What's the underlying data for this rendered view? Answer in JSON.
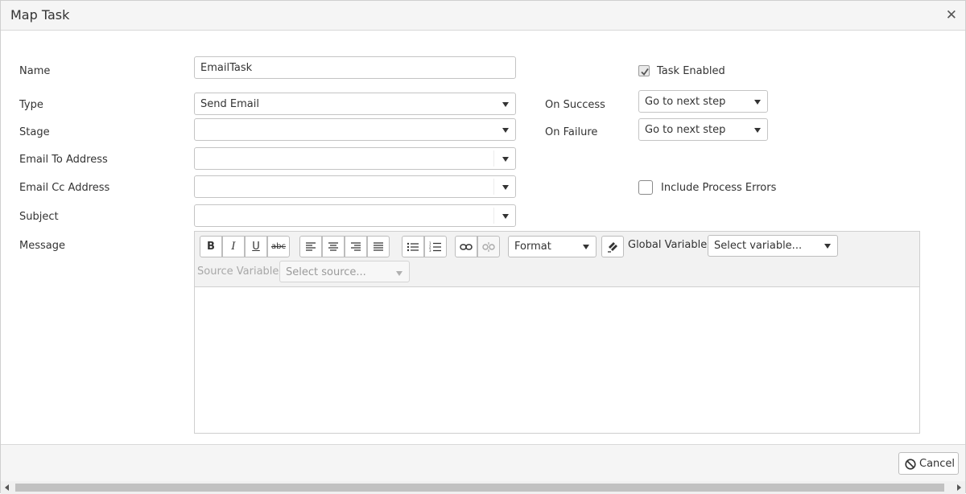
{
  "dialog": {
    "title": "Map Task",
    "close_glyph": "✕"
  },
  "form": {
    "name": {
      "label": "Name",
      "value": "EmailTask"
    },
    "type": {
      "label": "Type",
      "value": "Send Email"
    },
    "stage": {
      "label": "Stage",
      "value": ""
    },
    "email_to": {
      "label": "Email To Address",
      "value": ""
    },
    "email_cc": {
      "label": "Email Cc Address",
      "value": ""
    },
    "subject": {
      "label": "Subject",
      "value": ""
    },
    "message": {
      "label": "Message"
    },
    "task_enabled": {
      "label": "Task Enabled",
      "checked": true
    },
    "on_success": {
      "label": "On Success",
      "value": "Go to next step"
    },
    "on_failure": {
      "label": "On Failure",
      "value": "Go to next step"
    },
    "include_process_errors": {
      "label": "Include Process Errors",
      "checked": false
    }
  },
  "editor": {
    "toolbar": {
      "bold": "B",
      "italic": "I",
      "underline": "U",
      "strike": "abc",
      "format_select": "Format",
      "global_variable_label": "Global Variable:",
      "global_variable_placeholder": "Select variable...",
      "source_variable_label": "Source Variable:",
      "source_variable_placeholder": "Select source..."
    },
    "content": ""
  },
  "footer": {
    "cancel_label": "Cancel"
  },
  "icons": {
    "close": "close-icon",
    "caret": "chevron-down-icon",
    "check": "checkmark-icon",
    "cancel": "ban-icon"
  },
  "colors": {
    "header_bg": "#f5f5f5",
    "border": "#c4c4c4",
    "text": "#333333"
  }
}
